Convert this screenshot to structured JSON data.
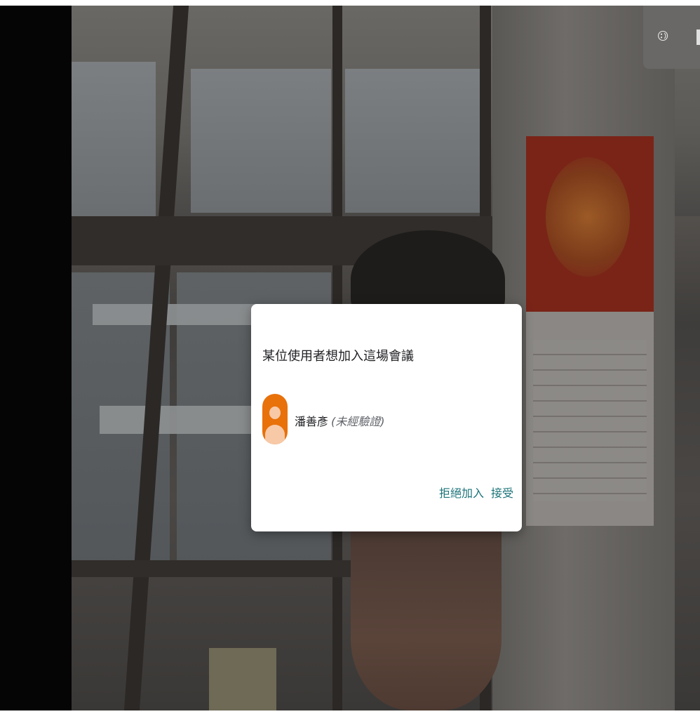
{
  "dialog": {
    "title": "某位使用者想加入這場會議",
    "requester_name": "潘善彥",
    "requester_status": "(未經驗證)",
    "deny_label": "拒絕加入",
    "accept_label": "接受"
  },
  "colors": {
    "accent": "#1a7378",
    "avatar": "#e8710a"
  },
  "icons": {
    "corner": "people-icon"
  }
}
